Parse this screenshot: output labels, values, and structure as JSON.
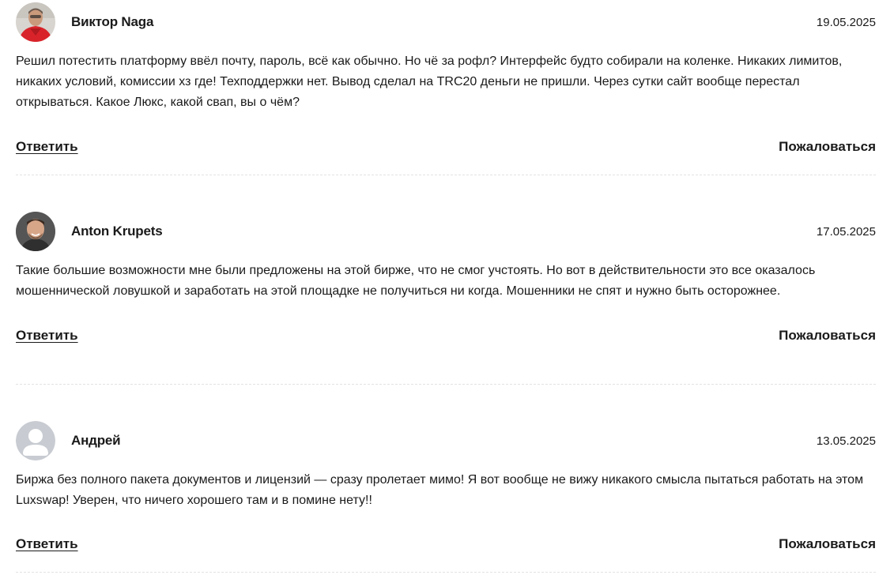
{
  "comments": [
    {
      "author": "Виктор Naga",
      "date": "19.05.2025",
      "text": "Решил потестить платформу ввёл почту, пароль, всё как обычно. Но чё за рофл? Интерфейс будто собирали на коленке. Никаких лимитов, никаких условий, комиссии хз где! Техподдержки нет. Вывод сделал на TRC20 деньги не пришли. Через сутки сайт вообще перестал открываться. Какое Люкс, какой свап, вы о чём?",
      "avatar": "avatar-photo-red-shirt",
      "reply_label": "Ответить",
      "report_label": "Пожаловаться"
    },
    {
      "author": "Anton Krupets",
      "date": "17.05.2025",
      "text": "Такие большие возможности мне были предложены на этой бирже, что не смог учстоять. Но вот в действительности это все оказалось мошеннической ловушкой и заработать на этой площадке не получиться ни когда. Мошенники не спят и нужно быть осторожнее.",
      "avatar": "avatar-photo-man",
      "reply_label": "Ответить",
      "report_label": "Пожаловаться"
    },
    {
      "author": "Андрей",
      "date": "13.05.2025",
      "text": "Биржа без полного пакета документов и лицензий — сразу пролетает мимо! Я вот вообще не вижу никакого смысла пытаться работать на этом Luxswap! Уверен, что ничего хорошего там и в помине нету!!",
      "avatar": "default-user-avatar-icon",
      "reply_label": "Ответить",
      "report_label": "Пожаловаться"
    }
  ]
}
